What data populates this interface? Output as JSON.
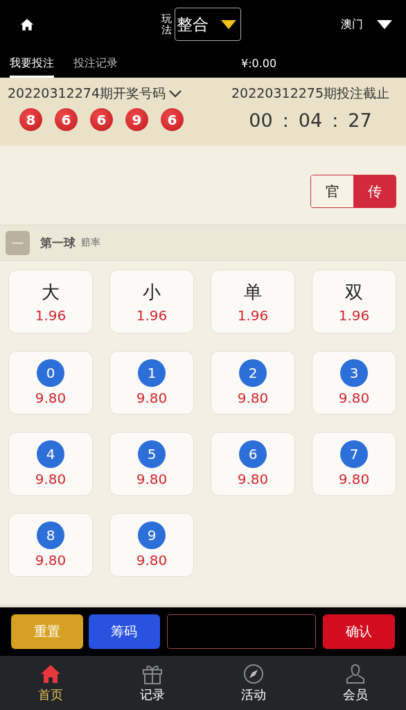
{
  "header": {
    "play_label": "玩法",
    "play_value": "整合",
    "region": "澳门"
  },
  "tabs": [
    {
      "label": "我要投注",
      "selected": true
    },
    {
      "label": "投注记录",
      "selected": false
    }
  ],
  "balance": "¥:0.00",
  "draw": {
    "last_title": "20220312274期开奖号码",
    "balls": [
      "8",
      "6",
      "6",
      "9",
      "6"
    ],
    "next_title": "20220312275期投注截止",
    "countdown": [
      "00",
      ":",
      "04",
      ":",
      "27"
    ]
  },
  "mode_toggle": [
    {
      "label": "官",
      "selected": false
    },
    {
      "label": "传",
      "selected": true
    }
  ],
  "section": {
    "collapse": "—",
    "title": "第一球",
    "subtitle": "赔率"
  },
  "options": [
    {
      "kind": "text",
      "label": "大",
      "odds": "1.96"
    },
    {
      "kind": "text",
      "label": "小",
      "odds": "1.96"
    },
    {
      "kind": "text",
      "label": "单",
      "odds": "1.96"
    },
    {
      "kind": "text",
      "label": "双",
      "odds": "1.96"
    },
    {
      "kind": "number",
      "label": "0",
      "odds": "9.80"
    },
    {
      "kind": "number",
      "label": "1",
      "odds": "9.80"
    },
    {
      "kind": "number",
      "label": "2",
      "odds": "9.80"
    },
    {
      "kind": "number",
      "label": "3",
      "odds": "9.80"
    },
    {
      "kind": "number",
      "label": "4",
      "odds": "9.80"
    },
    {
      "kind": "number",
      "label": "5",
      "odds": "9.80"
    },
    {
      "kind": "number",
      "label": "6",
      "odds": "9.80"
    },
    {
      "kind": "number",
      "label": "7",
      "odds": "9.80"
    },
    {
      "kind": "number",
      "label": "8",
      "odds": "9.80"
    },
    {
      "kind": "number",
      "label": "9",
      "odds": "9.80"
    }
  ],
  "actions": {
    "reset": "重置",
    "chips": "筹码",
    "confirm": "确认"
  },
  "nav": [
    {
      "label": "首页",
      "selected": true
    },
    {
      "label": "记录",
      "selected": false
    },
    {
      "label": "活动",
      "selected": false
    },
    {
      "label": "会员",
      "selected": false
    }
  ]
}
